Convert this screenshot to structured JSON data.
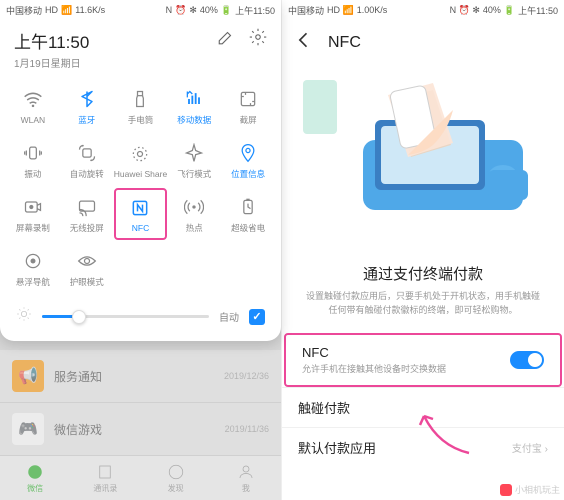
{
  "left": {
    "statusbar": {
      "carrier": "中国移动",
      "speed": "11.6K/s",
      "battery": "40%",
      "time": "上午11:50"
    },
    "panel": {
      "time": "上午11:50",
      "date": "1月19日星期日",
      "tiles": [
        {
          "label": "WLAN",
          "icon": "wifi",
          "active": false
        },
        {
          "label": "蓝牙",
          "icon": "bluetooth",
          "active": true
        },
        {
          "label": "手电筒",
          "icon": "flashlight",
          "active": false
        },
        {
          "label": "移动数据",
          "icon": "cellular",
          "active": true
        },
        {
          "label": "截屏",
          "icon": "screenshot",
          "active": false
        },
        {
          "label": "振动",
          "icon": "vibrate",
          "active": false
        },
        {
          "label": "自动旋转",
          "icon": "rotate",
          "active": false
        },
        {
          "label": "Huawei Share",
          "icon": "share",
          "active": false
        },
        {
          "label": "飞行模式",
          "icon": "airplane",
          "active": false
        },
        {
          "label": "位置信息",
          "icon": "location",
          "active": true
        },
        {
          "label": "屏幕录制",
          "icon": "record",
          "active": false
        },
        {
          "label": "无线投屏",
          "icon": "cast",
          "active": false
        },
        {
          "label": "NFC",
          "icon": "nfc",
          "active": true,
          "highlighted": true
        },
        {
          "label": "热点",
          "icon": "hotspot",
          "active": false
        },
        {
          "label": "超级省电",
          "icon": "powersave",
          "active": false
        },
        {
          "label": "悬浮导航",
          "icon": "float-nav",
          "active": false
        },
        {
          "label": "护眼模式",
          "icon": "eye-protect",
          "active": false
        }
      ],
      "auto_label": "自动"
    },
    "bg": {
      "svc1_title": "服务通知",
      "svc1_sub": "···",
      "svc1_time": "2019/12/36",
      "svc2_title": "微信游戏",
      "svc2_sub": "···",
      "svc2_time": "2019/11/36",
      "nav": [
        "微信",
        "通讯录",
        "发现",
        "我"
      ]
    }
  },
  "right": {
    "statusbar": {
      "carrier": "中国移动",
      "speed": "1.00K/s",
      "battery": "40%",
      "time": "上午11:50"
    },
    "header_title": "NFC",
    "desc_title": "通过支付终端付款",
    "desc_sub": "设置触碰付款应用后，只要手机处于开机状态，用手机触碰任何带有触碰付款徽标的终端，即可轻松购物。",
    "nfc_row": {
      "title": "NFC",
      "sub": "允许手机在接触其他设备时交换数据"
    },
    "touch_pay": "触碰付款",
    "default_app": {
      "label": "默认付款应用",
      "value": "支付宝"
    },
    "watermark": "小相机玩主"
  }
}
